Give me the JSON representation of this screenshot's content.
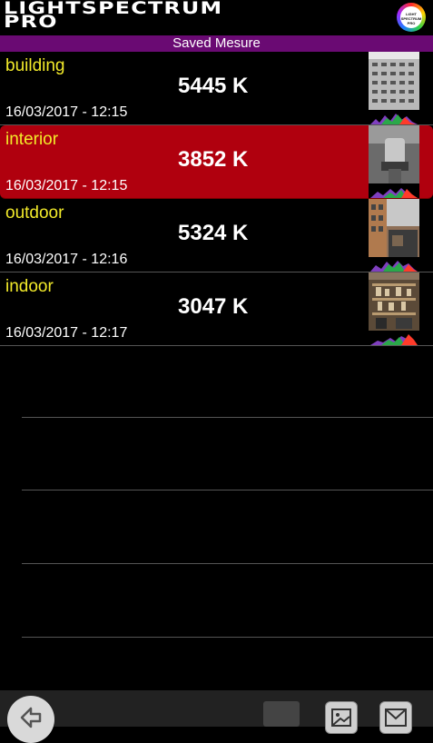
{
  "header": {
    "title_line1": "LIGHTSPECTRUM",
    "title_line2": "PRO",
    "logo_text": "LIGHT SPECTRUM PRO"
  },
  "subtitle": "Saved Mesure",
  "measures": [
    {
      "name": "building",
      "temp": "5445 K",
      "date": "16/03/2017 - 12:15",
      "selected": false
    },
    {
      "name": "interior",
      "temp": "3852 K",
      "date": "16/03/2017 - 12:15",
      "selected": true
    },
    {
      "name": "outdoor",
      "temp": "5324 K",
      "date": "16/03/2017 - 12:16",
      "selected": false
    },
    {
      "name": "indoor",
      "temp": "3047 K",
      "date": "16/03/2017 - 12:17",
      "selected": false
    }
  ],
  "colors": {
    "accent_purple": "#6a0a73",
    "selected_red": "#b0000e",
    "name_yellow": "#f2ea2a"
  },
  "toolbar": {
    "icons": [
      "back-icon",
      "image-icon",
      "mail-icon"
    ]
  }
}
